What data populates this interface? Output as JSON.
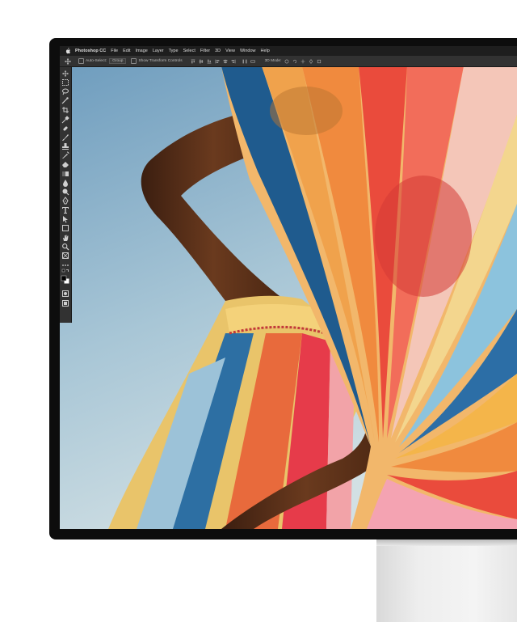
{
  "app": {
    "name": "Photoshop CC",
    "menus": [
      "File",
      "Edit",
      "Image",
      "Layer",
      "Type",
      "Select",
      "Filter",
      "3D",
      "View",
      "Window",
      "Help"
    ]
  },
  "options_bar": {
    "auto_select_label": "Auto-Select:",
    "auto_select_value": "Group",
    "transform_label": "Show Transform Controls",
    "mode_label": "3D Mode:"
  },
  "toolbar": {
    "tools": [
      "move-icon",
      "marquee-icon",
      "lasso-icon",
      "magic-wand-icon",
      "crop-icon",
      "eyedropper-icon",
      "healing-icon",
      "brush-icon",
      "stamp-icon",
      "history-brush-icon",
      "eraser-icon",
      "gradient-icon",
      "blur-icon",
      "dodge-icon",
      "pen-icon",
      "type-icon",
      "path-select-icon",
      "shape-icon",
      "hand-icon",
      "zoom-icon",
      "frame-icon",
      "more-icon",
      "swap-colors-icon",
      "color-swatches-icon",
      "quick-mask-icon",
      "screen-mode-icon"
    ]
  },
  "colors": {
    "bezel": "#0d0d0d",
    "chrome": "#323232",
    "menubar": "#1e1e1e",
    "sky_top": "#7ea9c6",
    "sky_bottom": "#c9dbe2"
  }
}
